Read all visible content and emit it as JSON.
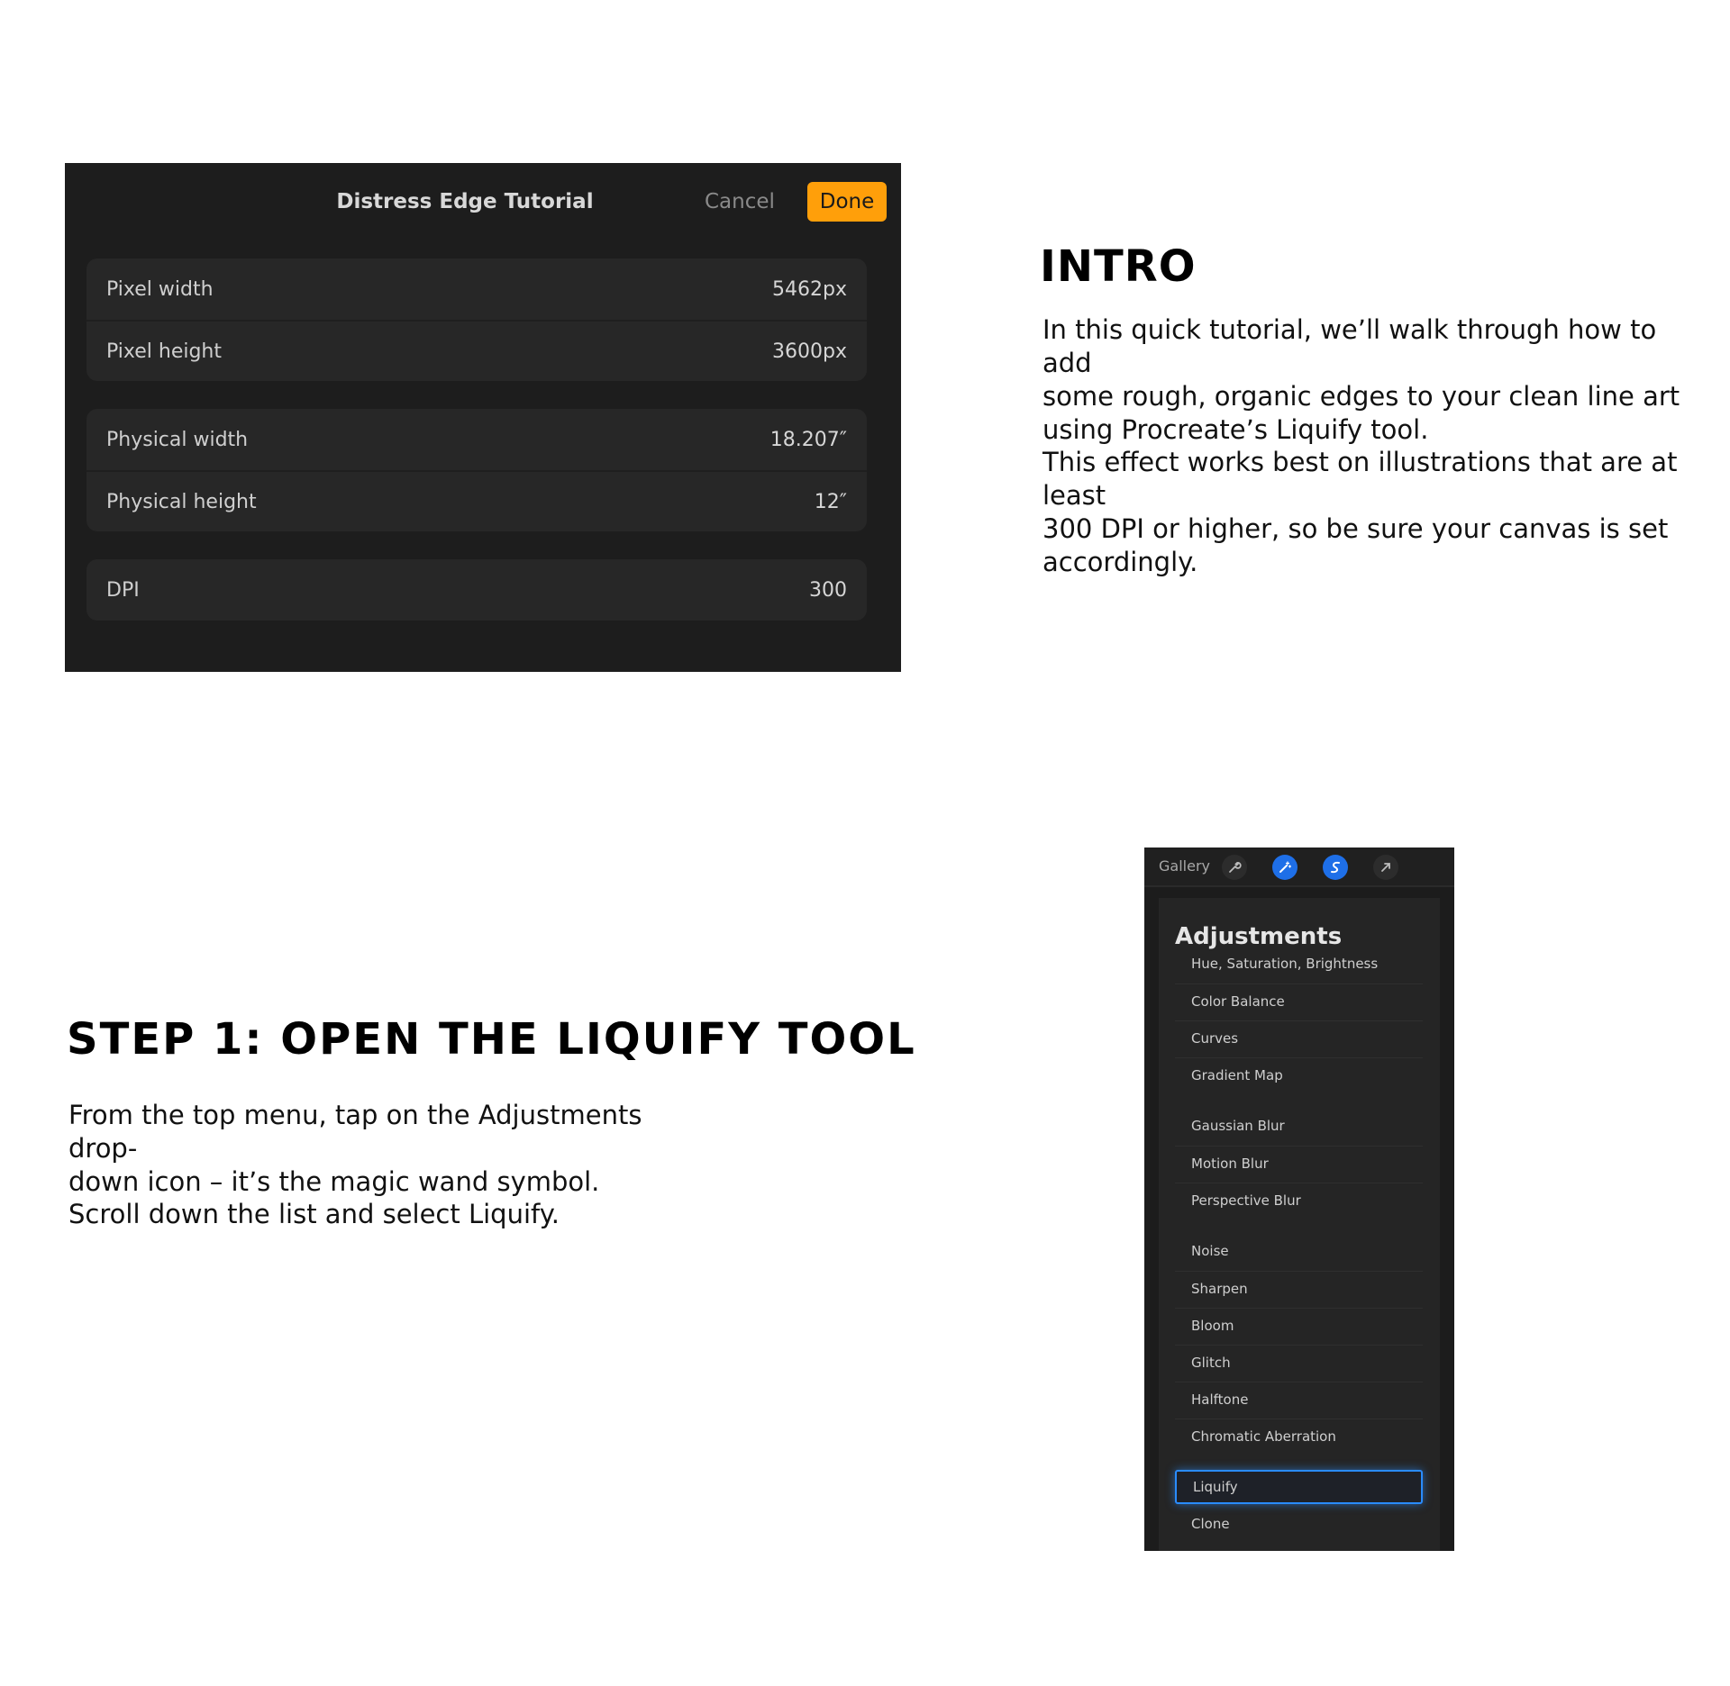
{
  "dialog": {
    "title": "Distress Edge Tutorial",
    "cancel_label": "Cancel",
    "done_label": "Done",
    "rows": [
      {
        "label": "Pixel width",
        "value": "5462px"
      },
      {
        "label": "Pixel height",
        "value": "3600px"
      },
      {
        "label": "Physical width",
        "value": "18.207″"
      },
      {
        "label": "Physical height",
        "value": "12″"
      },
      {
        "label": "DPI",
        "value": "300"
      }
    ]
  },
  "intro": {
    "heading": "INTRO",
    "para1_lines": [
      "In this quick tutorial, we’ll walk through how to add",
      "some rough, organic edges to your clean line art",
      "using Procreate’s Liquify tool."
    ],
    "para2_lines": [
      "This effect works best on illustrations that are at least",
      "300 DPI or higher, so be sure your canvas is set",
      "accordingly."
    ]
  },
  "step1": {
    "heading": "STEP 1: OPEN THE LIQUIFY TOOL",
    "para1_lines": [
      "From the top menu, tap on the Adjustments drop-",
      "down icon – it’s the magic wand symbol."
    ],
    "para2": "Scroll down the list and select Liquify."
  },
  "menu": {
    "gallery_label": "Gallery",
    "icons": [
      "wrench-icon",
      "magic-wand-icon",
      "selection-icon",
      "transform-arrow-icon"
    ],
    "title": "Adjustments",
    "items": [
      "Hue, Saturation, Brightness",
      "Color Balance",
      "Curves",
      "Gradient Map",
      "Gaussian Blur",
      "Motion Blur",
      "Perspective Blur",
      "Noise",
      "Sharpen",
      "Bloom",
      "Glitch",
      "Halftone",
      "Chromatic Aberration",
      "Liquify",
      "Clone"
    ],
    "selected_item": "Liquify",
    "accent_color": "#1e6fe8",
    "done_color": "#ff9f0a"
  }
}
